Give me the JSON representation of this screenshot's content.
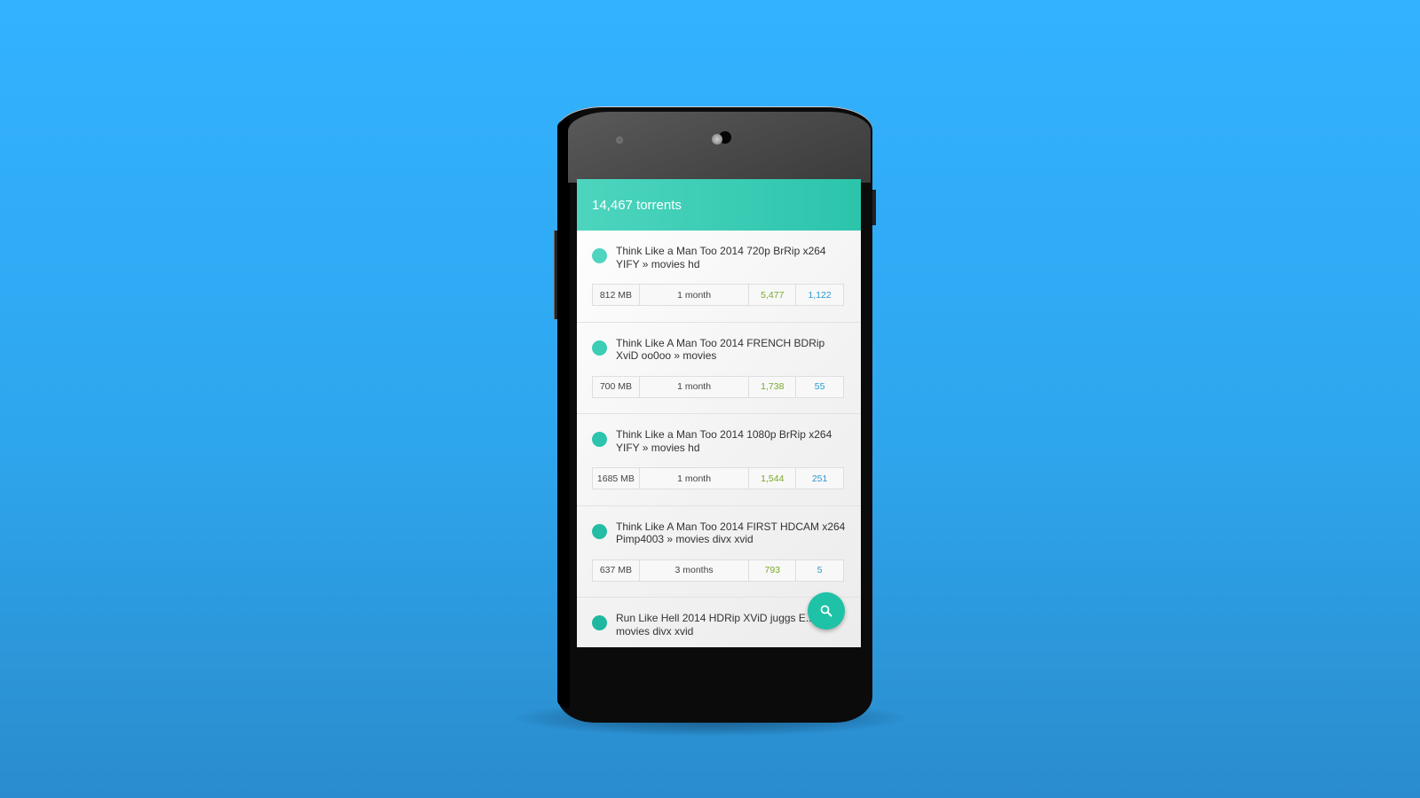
{
  "app_bar": {
    "title": "14,467 torrents"
  },
  "torrents": [
    {
      "title": "Think Like a Man Too 2014 720p BrRip x264 YIFY » movies hd",
      "size": "812 MB",
      "age": "1 month",
      "seeders": "5,477",
      "leechers": "1,122",
      "dot_color": "#4fd4bf"
    },
    {
      "title": "Think Like A Man Too 2014 FRENCH BDRip XviD oo0oo » movies",
      "size": "700 MB",
      "age": "1 month",
      "seeders": "1,738",
      "leechers": "55",
      "dot_color": "#3dcdb5"
    },
    {
      "title": "Think Like a Man Too 2014 1080p BrRip x264 YIFY » movies hd",
      "size": "1685 MB",
      "age": "1 month",
      "seeders": "1,544",
      "leechers": "251",
      "dot_color": "#2cc4ac"
    },
    {
      "title": "Think Like A Man Too 2014 FIRST HDCAM x264 Pimp4003 » movies divx xvid",
      "size": "637 MB",
      "age": "3 months",
      "seeders": "793",
      "leechers": "5",
      "dot_color": "#24bda4"
    },
    {
      "title": "Run Like Hell 2014 HDRip XViD juggs E... movies divx xvid",
      "dot_color": "#1fb89f"
    }
  ],
  "fab": {
    "icon": "search-icon"
  },
  "colors": {
    "accent": "#2cc4ac",
    "seeders": "#7aa82a",
    "leechers": "#2a9ad0",
    "background": "#33b2ff"
  }
}
